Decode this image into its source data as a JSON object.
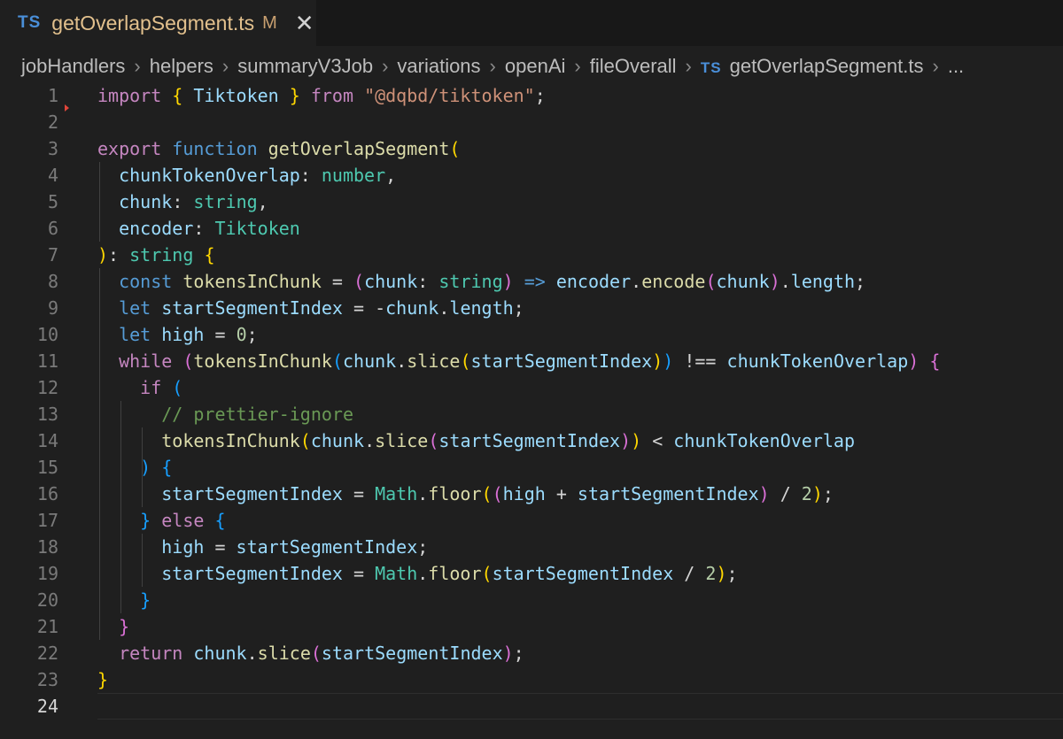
{
  "tab": {
    "icon": "TS",
    "title": "getOverlapSegment.ts",
    "modified": "M",
    "close": "✕"
  },
  "breadcrumb": {
    "items": [
      "jobHandlers",
      "helpers",
      "summaryV3Job",
      "variations",
      "openAi",
      "fileOverall"
    ],
    "file_icon": "TS",
    "file": "getOverlapSegment.ts",
    "ellipsis": "..."
  },
  "editor": {
    "active_line": 24,
    "lines": [
      {
        "n": "1",
        "segs": [
          [
            "k",
            "import "
          ],
          [
            "y",
            "{ "
          ],
          [
            "v",
            "Tiktoken"
          ],
          [
            "y",
            " }"
          ],
          [
            "k",
            " from "
          ],
          [
            "s",
            "\"@dqbd/tiktoken\""
          ],
          [
            "d",
            ";"
          ]
        ]
      },
      {
        "n": "2",
        "segs": []
      },
      {
        "n": "3",
        "segs": [
          [
            "k",
            "export "
          ],
          [
            "b",
            "function "
          ],
          [
            "f",
            "getOverlapSegment"
          ],
          [
            "y",
            "("
          ]
        ]
      },
      {
        "n": "4",
        "segs": [
          [
            "d",
            "  "
          ],
          [
            "v",
            "chunkTokenOverlap"
          ],
          [
            "d",
            ": "
          ],
          [
            "t",
            "number"
          ],
          [
            "d",
            ","
          ]
        ]
      },
      {
        "n": "5",
        "segs": [
          [
            "d",
            "  "
          ],
          [
            "v",
            "chunk"
          ],
          [
            "d",
            ": "
          ],
          [
            "t",
            "string"
          ],
          [
            "d",
            ","
          ]
        ]
      },
      {
        "n": "6",
        "segs": [
          [
            "d",
            "  "
          ],
          [
            "v",
            "encoder"
          ],
          [
            "d",
            ": "
          ],
          [
            "t",
            "Tiktoken"
          ]
        ]
      },
      {
        "n": "7",
        "segs": [
          [
            "y",
            ")"
          ],
          [
            "d",
            ": "
          ],
          [
            "t",
            "string"
          ],
          [
            "d",
            " "
          ],
          [
            "y",
            "{"
          ]
        ]
      },
      {
        "n": "8",
        "segs": [
          [
            "d",
            "  "
          ],
          [
            "b",
            "const "
          ],
          [
            "f",
            "tokensInChunk"
          ],
          [
            "d",
            " = "
          ],
          [
            "p",
            "("
          ],
          [
            "v",
            "chunk"
          ],
          [
            "d",
            ": "
          ],
          [
            "t",
            "string"
          ],
          [
            "p",
            ")"
          ],
          [
            "b",
            " => "
          ],
          [
            "v",
            "encoder"
          ],
          [
            "d",
            "."
          ],
          [
            "f",
            "encode"
          ],
          [
            "p",
            "("
          ],
          [
            "v",
            "chunk"
          ],
          [
            "p",
            ")"
          ],
          [
            "d",
            "."
          ],
          [
            "v",
            "length"
          ],
          [
            "d",
            ";"
          ]
        ]
      },
      {
        "n": "9",
        "segs": [
          [
            "d",
            "  "
          ],
          [
            "b",
            "let "
          ],
          [
            "v",
            "startSegmentIndex"
          ],
          [
            "d",
            " = -"
          ],
          [
            "v",
            "chunk"
          ],
          [
            "d",
            "."
          ],
          [
            "v",
            "length"
          ],
          [
            "d",
            ";"
          ]
        ]
      },
      {
        "n": "10",
        "segs": [
          [
            "d",
            "  "
          ],
          [
            "b",
            "let "
          ],
          [
            "v",
            "high"
          ],
          [
            "d",
            " = "
          ],
          [
            "n",
            "0"
          ],
          [
            "d",
            ";"
          ]
        ]
      },
      {
        "n": "11",
        "segs": [
          [
            "d",
            "  "
          ],
          [
            "k",
            "while "
          ],
          [
            "p",
            "("
          ],
          [
            "f",
            "tokensInChunk"
          ],
          [
            "u",
            "("
          ],
          [
            "v",
            "chunk"
          ],
          [
            "d",
            "."
          ],
          [
            "f",
            "slice"
          ],
          [
            "y",
            "("
          ],
          [
            "v",
            "startSegmentIndex"
          ],
          [
            "y",
            ")"
          ],
          [
            "u",
            ")"
          ],
          [
            "d",
            " !== "
          ],
          [
            "v",
            "chunkTokenOverlap"
          ],
          [
            "p",
            ")"
          ],
          [
            "d",
            " "
          ],
          [
            "p",
            "{"
          ]
        ]
      },
      {
        "n": "12",
        "segs": [
          [
            "d",
            "    "
          ],
          [
            "k",
            "if "
          ],
          [
            "u",
            "("
          ]
        ]
      },
      {
        "n": "13",
        "segs": [
          [
            "d",
            "      "
          ],
          [
            "c",
            "// prettier-ignore"
          ]
        ]
      },
      {
        "n": "14",
        "segs": [
          [
            "d",
            "      "
          ],
          [
            "f",
            "tokensInChunk"
          ],
          [
            "y",
            "("
          ],
          [
            "v",
            "chunk"
          ],
          [
            "d",
            "."
          ],
          [
            "f",
            "slice"
          ],
          [
            "p",
            "("
          ],
          [
            "v",
            "startSegmentIndex"
          ],
          [
            "p",
            ")"
          ],
          [
            "y",
            ")"
          ],
          [
            "d",
            " < "
          ],
          [
            "v",
            "chunkTokenOverlap"
          ]
        ]
      },
      {
        "n": "15",
        "segs": [
          [
            "d",
            "    "
          ],
          [
            "u",
            ")"
          ],
          [
            "d",
            " "
          ],
          [
            "u",
            "{"
          ]
        ]
      },
      {
        "n": "16",
        "segs": [
          [
            "d",
            "      "
          ],
          [
            "v",
            "startSegmentIndex"
          ],
          [
            "d",
            " = "
          ],
          [
            "t",
            "Math"
          ],
          [
            "d",
            "."
          ],
          [
            "f",
            "floor"
          ],
          [
            "y",
            "("
          ],
          [
            "p",
            "("
          ],
          [
            "v",
            "high"
          ],
          [
            "d",
            " + "
          ],
          [
            "v",
            "startSegmentIndex"
          ],
          [
            "p",
            ")"
          ],
          [
            "d",
            " / "
          ],
          [
            "n",
            "2"
          ],
          [
            "y",
            ")"
          ],
          [
            "d",
            ";"
          ]
        ]
      },
      {
        "n": "17",
        "segs": [
          [
            "d",
            "    "
          ],
          [
            "u",
            "}"
          ],
          [
            "k",
            " else "
          ],
          [
            "u",
            "{"
          ]
        ]
      },
      {
        "n": "18",
        "segs": [
          [
            "d",
            "      "
          ],
          [
            "v",
            "high"
          ],
          [
            "d",
            " = "
          ],
          [
            "v",
            "startSegmentIndex"
          ],
          [
            "d",
            ";"
          ]
        ]
      },
      {
        "n": "19",
        "segs": [
          [
            "d",
            "      "
          ],
          [
            "v",
            "startSegmentIndex"
          ],
          [
            "d",
            " = "
          ],
          [
            "t",
            "Math"
          ],
          [
            "d",
            "."
          ],
          [
            "f",
            "floor"
          ],
          [
            "y",
            "("
          ],
          [
            "v",
            "startSegmentIndex"
          ],
          [
            "d",
            " / "
          ],
          [
            "n",
            "2"
          ],
          [
            "y",
            ")"
          ],
          [
            "d",
            ";"
          ]
        ]
      },
      {
        "n": "20",
        "segs": [
          [
            "d",
            "    "
          ],
          [
            "u",
            "}"
          ]
        ]
      },
      {
        "n": "21",
        "segs": [
          [
            "d",
            "  "
          ],
          [
            "p",
            "}"
          ]
        ]
      },
      {
        "n": "22",
        "segs": [
          [
            "d",
            "  "
          ],
          [
            "k",
            "return "
          ],
          [
            "v",
            "chunk"
          ],
          [
            "d",
            "."
          ],
          [
            "f",
            "slice"
          ],
          [
            "p",
            "("
          ],
          [
            "v",
            "startSegmentIndex"
          ],
          [
            "p",
            ")"
          ],
          [
            "d",
            ";"
          ]
        ]
      },
      {
        "n": "23",
        "segs": [
          [
            "y",
            "}"
          ]
        ]
      },
      {
        "n": "24",
        "segs": []
      }
    ]
  }
}
